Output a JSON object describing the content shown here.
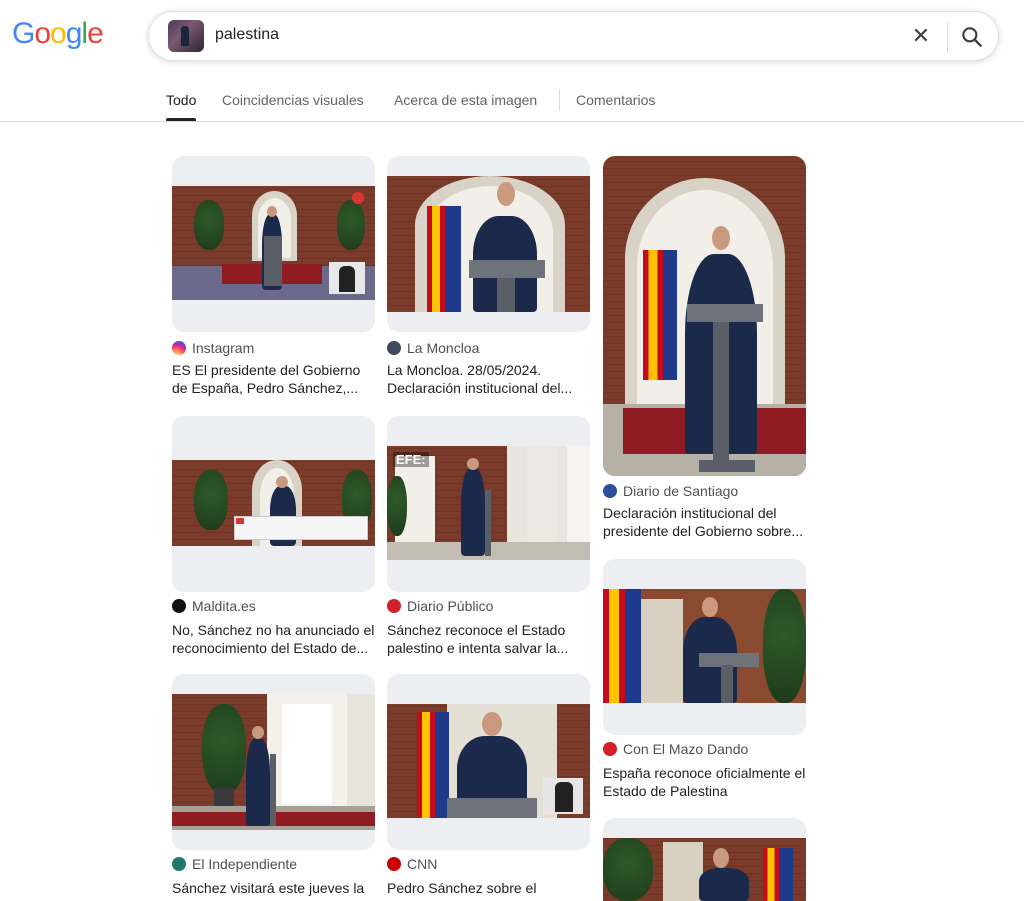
{
  "logo": [
    "G",
    "o",
    "o",
    "g",
    "l",
    "e"
  ],
  "search": {
    "query": "palestina",
    "clear_icon": "close-icon",
    "search_icon": "search-icon"
  },
  "tabs": [
    {
      "label": "Todo",
      "active": true
    },
    {
      "label": "Coincidencias visuales",
      "active": false
    },
    {
      "label": "Acerca de esta imagen",
      "active": false
    },
    {
      "label": "Comentarios",
      "active": false
    }
  ],
  "results": [
    {
      "source": "Instagram",
      "favicon_color": "#e1306c",
      "title": "ES El presidente del Gobierno de España, Pedro Sánchez,..."
    },
    {
      "source": "La Moncloa",
      "favicon_color": "#3c4a5c",
      "title": "La Moncloa. 28/05/2024. Declaración institucional del..."
    },
    {
      "source": "Diario de Santiago",
      "favicon_color": "#2b4f9c",
      "title": "Declaración institucional del presidente del Gobierno sobre..."
    },
    {
      "source": "Maldita.es",
      "favicon_color": "#111111",
      "title": "No, Sánchez no ha anunciado el reconocimiento del Estado de..."
    },
    {
      "source": "Diario Público",
      "favicon_color": "#d4202a",
      "title": "Sánchez reconoce el Estado palestino e intenta salvar la..."
    },
    {
      "source": "Con El Mazo Dando",
      "favicon_color": "#d41f26",
      "title": "España reconoce oficialmente el Estado de Palestina"
    },
    {
      "source": "El Independiente",
      "favicon_color": "#1f7a6b",
      "title": "Sánchez visitará este jueves la sede Palestina para..."
    },
    {
      "source": "CNN",
      "favicon_color": "#cc0000",
      "title": "Pedro Sánchez sobre el reconocimiento del Estado..."
    }
  ],
  "overlay_text": {
    "efe": "EFE:"
  }
}
